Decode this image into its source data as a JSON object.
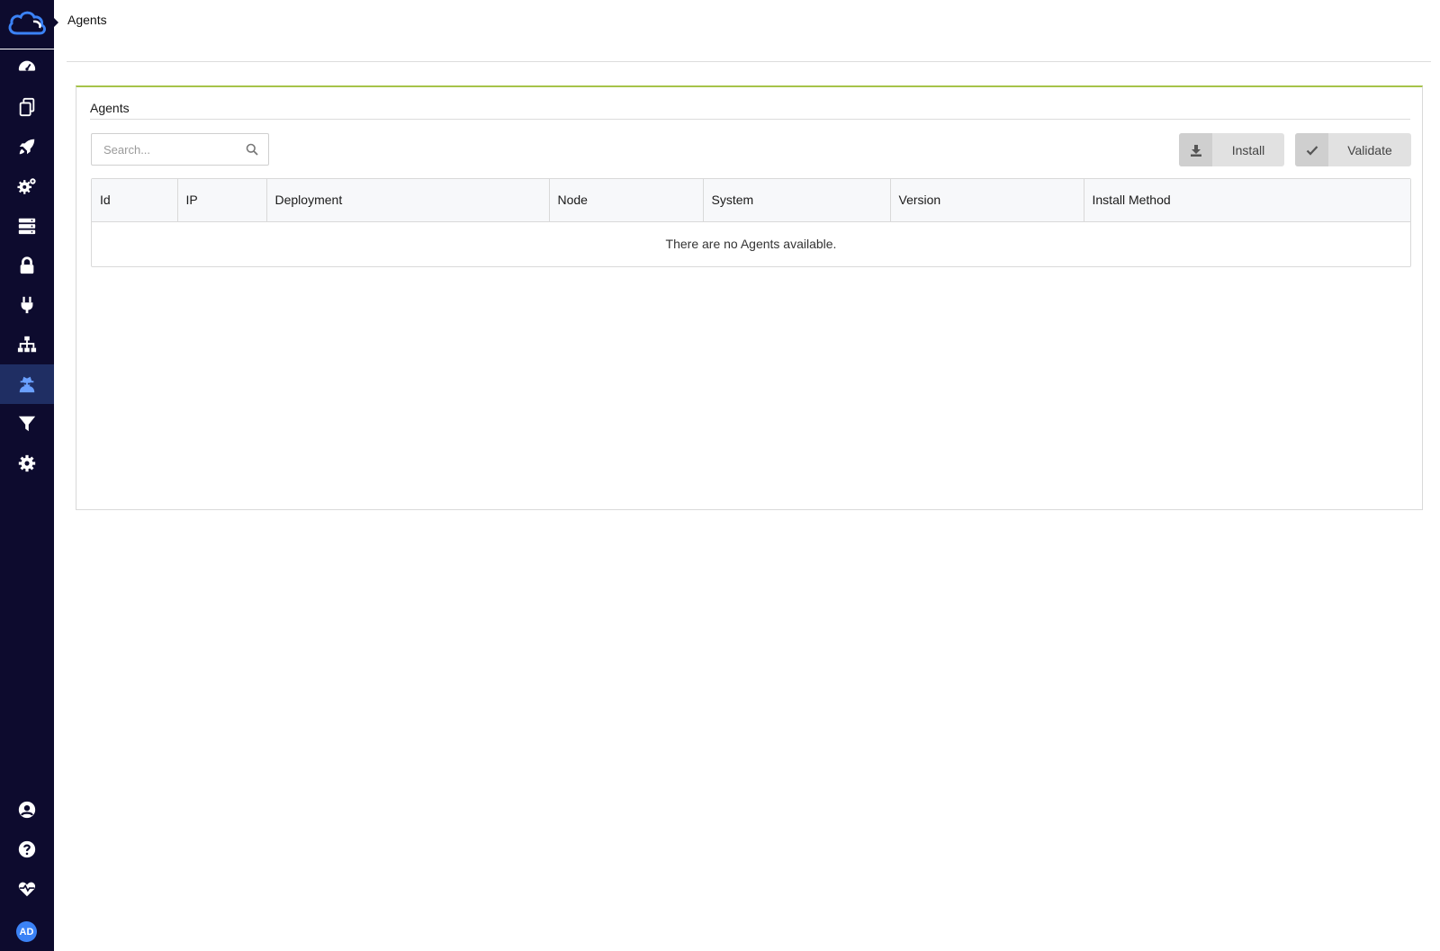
{
  "header": {
    "title": "Agents"
  },
  "sidebar": {
    "items": [
      {
        "name": "dashboard",
        "icon": "speedometer-icon"
      },
      {
        "name": "documents",
        "icon": "copy-icon"
      },
      {
        "name": "deployments",
        "icon": "rocket-icon"
      },
      {
        "name": "services",
        "icon": "gears-icon"
      },
      {
        "name": "servers",
        "icon": "server-icon"
      },
      {
        "name": "security",
        "icon": "lock-icon"
      },
      {
        "name": "plugins",
        "icon": "plug-icon"
      },
      {
        "name": "topology",
        "icon": "sitemap-icon"
      },
      {
        "name": "agents",
        "icon": "user-secret-icon",
        "active": true
      },
      {
        "name": "filters",
        "icon": "filter-icon"
      },
      {
        "name": "settings",
        "icon": "gear-icon"
      }
    ],
    "bottom": [
      {
        "name": "account",
        "icon": "user-circle-icon"
      },
      {
        "name": "help",
        "icon": "question-circle-icon"
      },
      {
        "name": "health",
        "icon": "heartbeat-icon"
      }
    ],
    "avatar_initials": "AD"
  },
  "panel": {
    "title": "Agents",
    "search_placeholder": "Search...",
    "install_label": "Install",
    "validate_label": "Validate"
  },
  "table": {
    "columns": [
      "Id",
      "IP",
      "Deployment",
      "Node",
      "System",
      "Version",
      "Install Method"
    ],
    "empty_message": "There are no Agents available."
  },
  "colors": {
    "sidebar_bg": "#0d0b2e",
    "sidebar_active": "#1f2e63",
    "panel_accent": "#a6c34a",
    "avatar": "#3b82f6"
  }
}
